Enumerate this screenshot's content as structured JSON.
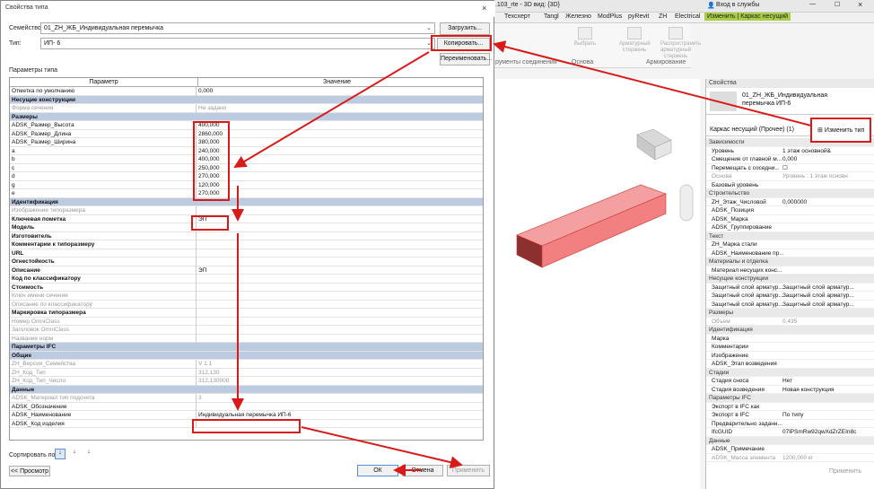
{
  "revit": {
    "title": "2.103_rte - 3D вид: {3D}",
    "signin": "Вход в службы",
    "tabs": [
      "Техсхерт",
      "Tangl",
      "Железно",
      "ModPlus",
      "pyRevit",
      "ZH",
      "Electrical",
      "Изменить | Каркас несущий"
    ],
    "ribbon_buttons": [
      "Выбрать",
      "Арматурный стержень",
      "Распространить арматурный стержень"
    ],
    "ribbon_groups": [
      "рументы соединения",
      "Основа",
      "Армирование"
    ]
  },
  "props": {
    "header": "Свойства",
    "type_name": "01_ZH_ЖБ_Индивидуальная перемычка ИП-6",
    "edit_type": "Изменить тип",
    "filter": "Каркас несущий (Прочее) (1)",
    "apply": "Применить",
    "rows": [
      {
        "sec": "Зависимости"
      },
      {
        "k": "Уровень",
        "v": "1 этаж основной&"
      },
      {
        "k": "Смещение от главной м...",
        "v": "0,000"
      },
      {
        "k": "Перемещать с соседни...",
        "v": "☐"
      },
      {
        "k": "Основа",
        "v": "Уровень : 1 этаж основн",
        "dis": true
      },
      {
        "k": "Базовый уровень",
        "v": ""
      },
      {
        "sec": "Строительство"
      },
      {
        "k": "ZH_Этаж_Числовой",
        "v": "0,000000"
      },
      {
        "k": "ADSK_Позиция",
        "v": ""
      },
      {
        "k": "ADSK_Марка",
        "v": ""
      },
      {
        "k": "ADSK_Группирование",
        "v": ""
      },
      {
        "sec": "Текст"
      },
      {
        "k": "ZH_Марка стали",
        "v": ""
      },
      {
        "k": "ADSK_Наименование пр...",
        "v": ""
      },
      {
        "sec": "Материалы и отделка"
      },
      {
        "k": "Материал несущих конс...",
        "v": ""
      },
      {
        "sec": "Несущие конструкции"
      },
      {
        "k": "Защитный слой арматур...",
        "v": "Защитный слой арматур..."
      },
      {
        "k": "Защитный слой арматур...",
        "v": "Защитный слой арматур..."
      },
      {
        "k": "Защитный слой арматур...",
        "v": "Защитный слой арматур..."
      },
      {
        "sec": "Размеры"
      },
      {
        "k": "Объем",
        "v": "0,435",
        "dis": true
      },
      {
        "sec": "Идентификация"
      },
      {
        "k": "Марка",
        "v": ""
      },
      {
        "k": "Комментарии",
        "v": ""
      },
      {
        "k": "Изображение",
        "v": ""
      },
      {
        "k": "ADSK_Этап возведения",
        "v": ""
      },
      {
        "sec": "Стадии"
      },
      {
        "k": "Стадия сноса",
        "v": "Нет"
      },
      {
        "k": "Стадия возведения",
        "v": "Новая конструкция"
      },
      {
        "sec": "Параметры IFC"
      },
      {
        "k": "Экспорт в IFC как",
        "v": ""
      },
      {
        "k": "Экспорт в IFC",
        "v": "По типу"
      },
      {
        "k": "Предварительно заданн...",
        "v": ""
      },
      {
        "k": "IfcGUID",
        "v": "07lPSmRw92qwXdZrZEIn8c"
      },
      {
        "sec": "Данные"
      },
      {
        "k": "ADSK_Примечание",
        "v": ""
      },
      {
        "k": "ADSK_Масса элемента",
        "v": "1200,000 кг",
        "dis": true
      }
    ]
  },
  "dialog": {
    "title": "Свойства типа",
    "family_label": "Семейство:",
    "family_value": "01_ZH_ЖБ_Индивидуальная перемычка",
    "type_label": "Тип:",
    "type_value": "ИП- 6",
    "load": "Загрузить...",
    "copy": "Копировать...",
    "rename": "Переименовать...",
    "params_label": "Параметры типа",
    "col_param": "Параметр",
    "col_value": "Значение",
    "rows": [
      {
        "p": "Отметка по умолчанию",
        "v": "0,000"
      },
      {
        "sec": "Несущие конструкции"
      },
      {
        "p": "Форма сечения",
        "v": "Не задано",
        "dis": true
      },
      {
        "sec": "Размеры"
      },
      {
        "p": "ADSK_Размер_Высота",
        "v": "400,000"
      },
      {
        "p": "ADSK_Размер_Длина",
        "v": "2860,000"
      },
      {
        "p": "ADSK_Размер_Ширина",
        "v": "380,000"
      },
      {
        "p": "a",
        "v": "240,000"
      },
      {
        "p": "b",
        "v": "400,000"
      },
      {
        "p": "c",
        "v": "250,000"
      },
      {
        "p": "d",
        "v": "270,000"
      },
      {
        "p": "g",
        "v": "120,000"
      },
      {
        "p": "e",
        "v": "270,000"
      },
      {
        "sec": "Идентификация"
      },
      {
        "p": "Изображение типоразмера",
        "v": "",
        "dis": true
      },
      {
        "p": "Ключевая пометка",
        "v": "ЭП",
        "b": true
      },
      {
        "p": "Модель",
        "v": "",
        "b": true
      },
      {
        "p": "Изготовитель",
        "v": "",
        "b": true
      },
      {
        "p": "Комментарии к типоразмеру",
        "v": "",
        "b": true
      },
      {
        "p": "URL",
        "v": "",
        "b": true
      },
      {
        "p": "Огнестойкость",
        "v": "",
        "b": true
      },
      {
        "p": "Описание",
        "v": "ЭП",
        "b": true
      },
      {
        "p": "Код по классификатору",
        "v": "",
        "b": true
      },
      {
        "p": "Стоимость",
        "v": "",
        "b": true
      },
      {
        "p": "Ключ имени сечения",
        "v": "",
        "dis": true
      },
      {
        "p": "Описание по классификатору",
        "v": "",
        "dis": true
      },
      {
        "p": "Маркировка типоразмера",
        "v": "",
        "b": true
      },
      {
        "p": "Номер OmniClass",
        "v": "",
        "dis": true
      },
      {
        "p": "Заголовок OmniClass",
        "v": "",
        "dis": true
      },
      {
        "p": "Название норм",
        "v": "",
        "dis": true
      },
      {
        "sec": "Параметры IFC"
      },
      {
        "sec": "Общие"
      },
      {
        "p": "ZH_Версия_Семейства",
        "v": "V 1.1",
        "dis": true
      },
      {
        "p": "ZH_Код_Тип",
        "v": "312,130",
        "dis": true
      },
      {
        "p": "ZH_Код_Тип_Число",
        "v": "312,130000",
        "dis": true
      },
      {
        "sec": "Данные"
      },
      {
        "p": "ADSK_Материал тип подсчета",
        "v": "3",
        "dis": true
      },
      {
        "p": "ADSK_Обозначение",
        "v": ""
      },
      {
        "p": "ADSK_Наименование",
        "v": "Индивидуальная перемычка ИП-6"
      },
      {
        "p": "ADSK_Код изделия",
        "v": ""
      }
    ],
    "sort_label": "Сортировать по:",
    "preview": "<< Просмотр",
    "ok": "ОК",
    "cancel": "Отмена",
    "apply": "Применить"
  }
}
